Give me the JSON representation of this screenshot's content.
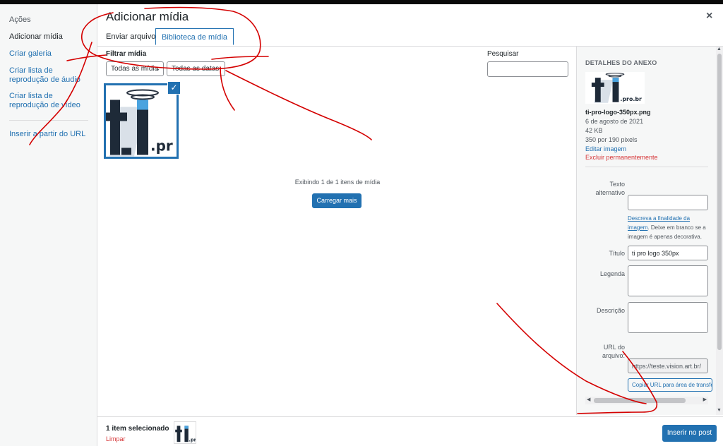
{
  "sidebar": {
    "heading": "Ações",
    "items": [
      {
        "label": "Adicionar mídia"
      },
      {
        "label": "Criar galeria"
      },
      {
        "label": "Criar lista de reprodução de áudio"
      },
      {
        "label": "Criar lista de reprodução de vídeo"
      },
      {
        "label": "Inserir a partir do URL"
      }
    ]
  },
  "header": {
    "title": "Adicionar mídia",
    "close": "×"
  },
  "tabs": [
    {
      "label": "Enviar arquivos"
    },
    {
      "label": "Biblioteca de mídia"
    }
  ],
  "filters": {
    "label": "Filtrar mídia",
    "type_select": "Todas as mídia",
    "date_select": "Todas as datas",
    "search_label": "Pesquisar",
    "search_value": ""
  },
  "library": {
    "logo_text": ".pr",
    "count_text": "Exibindo 1 de 1 itens de mídia",
    "load_more": "Carregar mais"
  },
  "details": {
    "heading": "DETALHES DO ANEXO",
    "filename": "ti-pro-logo-350px.png",
    "date": "6 de agosto de 2021",
    "size": "42 KB",
    "dimensions": "350 por 190 pixels",
    "edit_link": "Editar imagem",
    "delete_link": "Excluir permanentemente",
    "thumb_text": ".pro.br",
    "alt_label": "Texto alternativo",
    "alt_value": "",
    "help_link": "Descreva a finalidade da imagem",
    "help_text": ". Deixe em branco se a imagem é apenas decorativa.",
    "title_label": "Título",
    "title_value": "ti pro logo 350px",
    "caption_label": "Legenda",
    "caption_value": "",
    "description_label": "Descrição",
    "description_value": "",
    "url_label": "URL do arquivo:",
    "url_value": "https://teste.vision.art.br/",
    "copy_button": "Copiar URL para área de transferência"
  },
  "toolbar": {
    "selection_count": "1 item selecionado",
    "clear": "Limpar",
    "thumb_text": ".pr",
    "insert_button": "Inserir no post"
  },
  "colors": {
    "accent": "#2271b1",
    "danger": "#d63638",
    "annotation": "#d40000"
  }
}
